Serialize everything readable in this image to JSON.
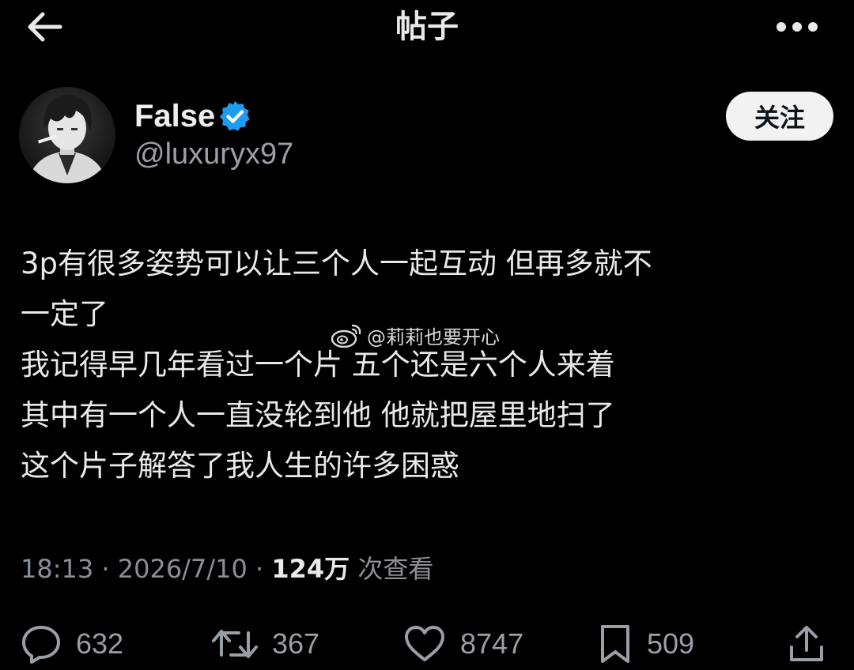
{
  "header": {
    "title": "帖子"
  },
  "author": {
    "display_name": "False",
    "handle": "@luxuryx97",
    "follow_label": "关注"
  },
  "post": {
    "lines": [
      "3p有很多姿势可以让三个人一起互动 但再多就不",
      "一定了",
      "我记得早几年看过一个片 五个还是六个人来着",
      "其中有一个人一直没轮到他 他就把屋里地扫了",
      "这个片子解答了我人生的许多困惑"
    ]
  },
  "watermark": {
    "text": "@莉莉也要开心"
  },
  "meta": {
    "time": "18:13",
    "date": "2026/7/10",
    "views": "124万",
    "views_label": "次查看"
  },
  "actions": {
    "replies": "632",
    "reposts": "367",
    "likes": "8747",
    "bookmarks": "509"
  },
  "colors": {
    "background": "#000000",
    "verified": "#1d9bf0",
    "muted_text": "#8b9096"
  }
}
